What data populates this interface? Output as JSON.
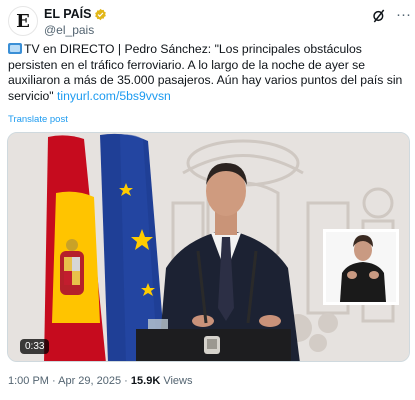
{
  "header": {
    "avatar_letter": "E",
    "account_name": "EL PAÍS",
    "handle": "@el_pais",
    "more_label": "···"
  },
  "post": {
    "text_main": "TV en DIRECTO | Pedro Sánchez: \"Los principales obstáculos persisten en el tráfico ferroviario. A lo largo de la noche de ayer se auxiliaron a más de 35.000 pasajeros. Aún hay varios puntos del país sin servicio\" ",
    "link_text": "tinyurl.com/5bs9vvsn",
    "translate_label": "Translate post"
  },
  "media": {
    "time_badge": "0:33"
  },
  "footer": {
    "timestamp": "1:00 PM · Apr 29, 2025 · ",
    "views_count": "15.9K",
    "views_label": " Views"
  },
  "colors": {
    "link": "#1d9bf0",
    "verified_badge": "#e2b719",
    "spain_red": "#c60b1e",
    "spain_yellow": "#ffc400",
    "eu_blue": "#003399"
  }
}
